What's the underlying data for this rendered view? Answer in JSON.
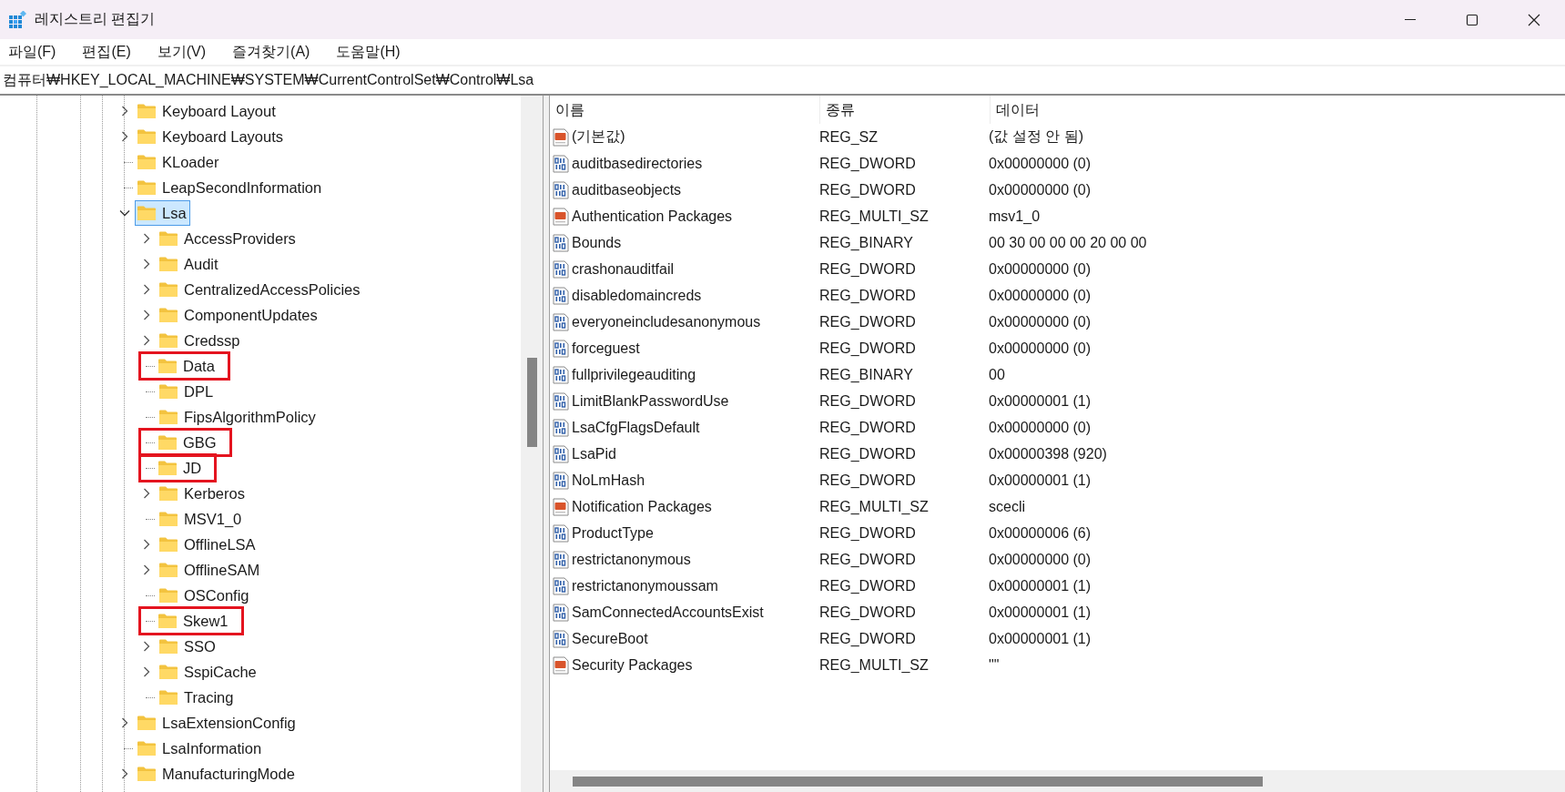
{
  "window": {
    "title": "레지스트리 편집기"
  },
  "menu": [
    "파일(F)",
    "편집(E)",
    "보기(V)",
    "즐겨찾기(A)",
    "도움말(H)"
  ],
  "address": "컴퓨터₩HKEY_LOCAL_MACHINE₩SYSTEM₩CurrentControlSet₩Control₩Lsa",
  "tree": [
    {
      "label": "Keyboard Layout",
      "expandable": true,
      "expanded": false,
      "selected": false,
      "marked": false
    },
    {
      "label": "Keyboard Layouts",
      "expandable": true,
      "expanded": false,
      "selected": false,
      "marked": false
    },
    {
      "label": "KLoader",
      "expandable": false,
      "selected": false,
      "marked": false
    },
    {
      "label": "LeapSecondInformation",
      "expandable": false,
      "selected": false,
      "marked": false
    },
    {
      "label": "Lsa",
      "expandable": true,
      "expanded": true,
      "selected": true,
      "marked": false,
      "children": [
        {
          "label": "AccessProviders",
          "expandable": true,
          "expanded": false,
          "selected": false,
          "marked": false
        },
        {
          "label": "Audit",
          "expandable": true,
          "expanded": false,
          "selected": false,
          "marked": false
        },
        {
          "label": "CentralizedAccessPolicies",
          "expandable": true,
          "expanded": false,
          "selected": false,
          "marked": false
        },
        {
          "label": "ComponentUpdates",
          "expandable": true,
          "expanded": false,
          "selected": false,
          "marked": false
        },
        {
          "label": "Credssp",
          "expandable": true,
          "expanded": false,
          "selected": false,
          "marked": false
        },
        {
          "label": "Data",
          "expandable": false,
          "selected": false,
          "marked": true
        },
        {
          "label": "DPL",
          "expandable": false,
          "selected": false,
          "marked": false
        },
        {
          "label": "FipsAlgorithmPolicy",
          "expandable": false,
          "selected": false,
          "marked": false
        },
        {
          "label": "GBG",
          "expandable": false,
          "selected": false,
          "marked": true
        },
        {
          "label": "JD",
          "expandable": false,
          "selected": false,
          "marked": true
        },
        {
          "label": "Kerberos",
          "expandable": true,
          "expanded": false,
          "selected": false,
          "marked": false
        },
        {
          "label": "MSV1_0",
          "expandable": false,
          "selected": false,
          "marked": false
        },
        {
          "label": "OfflineLSA",
          "expandable": true,
          "expanded": false,
          "selected": false,
          "marked": false
        },
        {
          "label": "OfflineSAM",
          "expandable": true,
          "expanded": false,
          "selected": false,
          "marked": false
        },
        {
          "label": "OSConfig",
          "expandable": false,
          "selected": false,
          "marked": false
        },
        {
          "label": "Skew1",
          "expandable": false,
          "selected": false,
          "marked": true
        },
        {
          "label": "SSO",
          "expandable": true,
          "expanded": false,
          "selected": false,
          "marked": false
        },
        {
          "label": "SspiCache",
          "expandable": true,
          "expanded": false,
          "selected": false,
          "marked": false
        },
        {
          "label": "Tracing",
          "expandable": false,
          "selected": false,
          "marked": false
        }
      ]
    },
    {
      "label": "LsaExtensionConfig",
      "expandable": true,
      "expanded": false,
      "selected": false,
      "marked": false
    },
    {
      "label": "LsaInformation",
      "expandable": false,
      "selected": false,
      "marked": false
    },
    {
      "label": "ManufacturingMode",
      "expandable": true,
      "expanded": false,
      "selected": false,
      "marked": false
    }
  ],
  "list": {
    "columns": [
      "이름",
      "종류",
      "데이터"
    ],
    "rows": [
      {
        "kind": "string",
        "name": "(기본값)",
        "type": "REG_SZ",
        "data": "(값 설정 안 됨)"
      },
      {
        "kind": "binary",
        "name": "auditbasedirectories",
        "type": "REG_DWORD",
        "data": "0x00000000 (0)"
      },
      {
        "kind": "binary",
        "name": "auditbaseobjects",
        "type": "REG_DWORD",
        "data": "0x00000000 (0)"
      },
      {
        "kind": "string",
        "name": "Authentication Packages",
        "type": "REG_MULTI_SZ",
        "data": "msv1_0"
      },
      {
        "kind": "binary",
        "name": "Bounds",
        "type": "REG_BINARY",
        "data": "00 30 00 00 00 20 00 00"
      },
      {
        "kind": "binary",
        "name": "crashonauditfail",
        "type": "REG_DWORD",
        "data": "0x00000000 (0)"
      },
      {
        "kind": "binary",
        "name": "disabledomaincreds",
        "type": "REG_DWORD",
        "data": "0x00000000 (0)"
      },
      {
        "kind": "binary",
        "name": "everyoneincludesanonymous",
        "type": "REG_DWORD",
        "data": "0x00000000 (0)"
      },
      {
        "kind": "binary",
        "name": "forceguest",
        "type": "REG_DWORD",
        "data": "0x00000000 (0)"
      },
      {
        "kind": "binary",
        "name": "fullprivilegeauditing",
        "type": "REG_BINARY",
        "data": "00"
      },
      {
        "kind": "binary",
        "name": "LimitBlankPasswordUse",
        "type": "REG_DWORD",
        "data": "0x00000001 (1)"
      },
      {
        "kind": "binary",
        "name": "LsaCfgFlagsDefault",
        "type": "REG_DWORD",
        "data": "0x00000000 (0)"
      },
      {
        "kind": "binary",
        "name": "LsaPid",
        "type": "REG_DWORD",
        "data": "0x00000398 (920)"
      },
      {
        "kind": "binary",
        "name": "NoLmHash",
        "type": "REG_DWORD",
        "data": "0x00000001 (1)"
      },
      {
        "kind": "string",
        "name": "Notification Packages",
        "type": "REG_MULTI_SZ",
        "data": "scecli"
      },
      {
        "kind": "binary",
        "name": "ProductType",
        "type": "REG_DWORD",
        "data": "0x00000006 (6)"
      },
      {
        "kind": "binary",
        "name": "restrictanonymous",
        "type": "REG_DWORD",
        "data": "0x00000000 (0)"
      },
      {
        "kind": "binary",
        "name": "restrictanonymoussam",
        "type": "REG_DWORD",
        "data": "0x00000001 (1)"
      },
      {
        "kind": "binary",
        "name": "SamConnectedAccountsExist",
        "type": "REG_DWORD",
        "data": "0x00000001 (1)"
      },
      {
        "kind": "binary",
        "name": "SecureBoot",
        "type": "REG_DWORD",
        "data": "0x00000001 (1)"
      },
      {
        "kind": "string",
        "name": "Security Packages",
        "type": "REG_MULTI_SZ",
        "data": "\"\""
      }
    ]
  }
}
